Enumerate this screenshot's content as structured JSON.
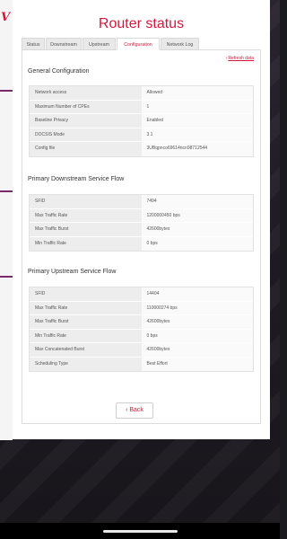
{
  "page": {
    "title": "Router status"
  },
  "tabs": [
    {
      "label": "Status"
    },
    {
      "label": "Downstream"
    },
    {
      "label": "Upstream"
    },
    {
      "label": "Configuration",
      "active": true
    },
    {
      "label": "Network Log"
    }
  ],
  "refresh": {
    "label": "Refresh data"
  },
  "general": {
    "title": "General Configuration",
    "rows": [
      {
        "label": "Network access",
        "value": "Allowed"
      },
      {
        "label": "Maximum Number of CPEs",
        "value": "1"
      },
      {
        "label": "Baseline Privacy",
        "value": "Enabled"
      },
      {
        "label": "DOCSIS Mode",
        "value": "3.1"
      },
      {
        "label": "Config file",
        "value": "3UBqpnco69614ncn98712544"
      }
    ]
  },
  "downstream": {
    "title": "Primary Downstream Service Flow",
    "rows": [
      {
        "label": "SFID",
        "value": "7494"
      },
      {
        "label": "Max Traffic Rate",
        "value": "1200000450 bps"
      },
      {
        "label": "Max Traffic Burst",
        "value": "42600bytes"
      },
      {
        "label": "Min Traffic Rate",
        "value": "0 bps"
      }
    ]
  },
  "upstream": {
    "title": "Primary Upstream Service Flow",
    "rows": [
      {
        "label": "SFID",
        "value": "14404"
      },
      {
        "label": "Max Traffic Rate",
        "value": "110000274 bps"
      },
      {
        "label": "Max Traffic Burst",
        "value": "42600bytes"
      },
      {
        "label": "Min Traffic Rate",
        "value": "0 bps"
      },
      {
        "label": "Max Concatenated Burst",
        "value": "42600bytes"
      },
      {
        "label": "Scheduling Type",
        "value": "Best Effort"
      }
    ]
  },
  "back": {
    "label": "Back"
  },
  "colors": {
    "accent": "#d4163c",
    "background": "#1b1b1f"
  }
}
